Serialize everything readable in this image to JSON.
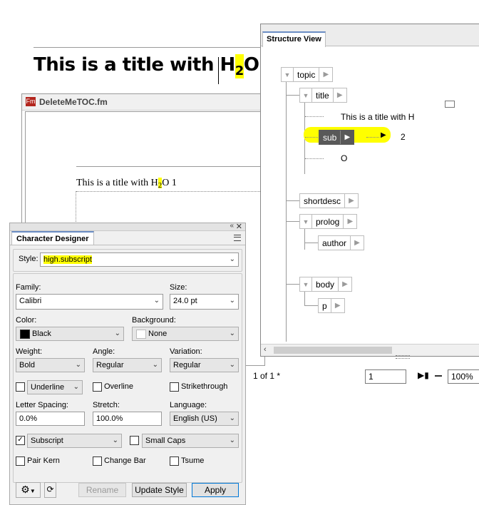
{
  "document": {
    "title_text": "This is a title with H",
    "title_sub": "2",
    "title_tail": "O",
    "window_icon": "Fm",
    "window_title": "DeleteMeTOC.fm",
    "body_text": "This is a title with H",
    "body_sub": "2",
    "body_tail": "O 1"
  },
  "structure_view": {
    "tab": "Structure View",
    "nodes": {
      "topic": "topic",
      "title": "title",
      "sub": "sub",
      "shortdesc": "shortdesc",
      "prolog": "prolog",
      "author": "author",
      "body": "body",
      "p": "p"
    },
    "text_title": "This is a title with H",
    "text_sub": "2",
    "text_o": "O"
  },
  "status_bar": {
    "page_info": "1 of 1 *",
    "page_field": "1",
    "zoom": "100%"
  },
  "character_designer": {
    "tab": "Character Designer",
    "style_label": "Style:",
    "style_value": "high.subscript",
    "family_label": "Family:",
    "family_value": "Calibri",
    "size_label": "Size:",
    "size_value": "24.0 pt",
    "color_label": "Color:",
    "color_value": "Black",
    "background_label": "Background:",
    "background_value": "None",
    "weight_label": "Weight:",
    "weight_value": "Bold",
    "angle_label": "Angle:",
    "angle_value": "Regular",
    "variation_label": "Variation:",
    "variation_value": "Regular",
    "underline_value": "Underline",
    "overline_label": "Overline",
    "strikethrough_label": "Strikethrough",
    "letter_spacing_label": "Letter Spacing:",
    "letter_spacing_value": "0.0%",
    "stretch_label": "Stretch:",
    "stretch_value": "100.0%",
    "language_label": "Language:",
    "language_value": "English (US)",
    "subscript_value": "Subscript",
    "small_caps_value": "Small Caps",
    "pair_kern_label": "Pair Kern",
    "change_bar_label": "Change Bar",
    "tsume_label": "Tsume",
    "rename_label": "Rename",
    "update_style_label": "Update Style",
    "apply_label": "Apply"
  },
  "colors": {
    "highlight": "#ffff00",
    "selected_node": "#595959",
    "color_swatch": "#000000"
  }
}
